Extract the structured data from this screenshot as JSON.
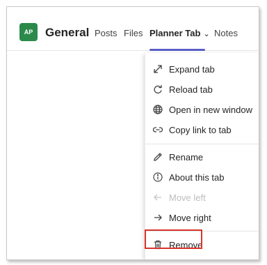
{
  "channel": {
    "avatar_initials": "AP",
    "title": "General"
  },
  "tabs": [
    {
      "label": "Posts"
    },
    {
      "label": "Files"
    },
    {
      "label": "Planner Tab"
    },
    {
      "label": "Notes"
    }
  ],
  "active_tab": "Planner Tab",
  "menu": {
    "items": [
      {
        "label": "Expand tab",
        "icon": "expand-icon",
        "enabled": true
      },
      {
        "label": "Reload tab",
        "icon": "reload-icon",
        "enabled": true
      },
      {
        "label": "Open in new window",
        "icon": "globe-icon",
        "enabled": true
      },
      {
        "label": "Copy link to tab",
        "icon": "link-icon",
        "enabled": true
      },
      {
        "label": "Rename",
        "icon": "pencil-icon",
        "enabled": true
      },
      {
        "label": "About this tab",
        "icon": "info-icon",
        "enabled": true
      },
      {
        "label": "Move left",
        "icon": "arrow-left-icon",
        "enabled": false
      },
      {
        "label": "Move right",
        "icon": "arrow-right-icon",
        "enabled": true
      },
      {
        "label": "Remove",
        "icon": "trash-icon",
        "enabled": true,
        "highlighted": true
      }
    ]
  },
  "colors": {
    "accent": "#5b5fc7",
    "avatar": "#2b8a4a",
    "highlight": "#d9342b"
  }
}
